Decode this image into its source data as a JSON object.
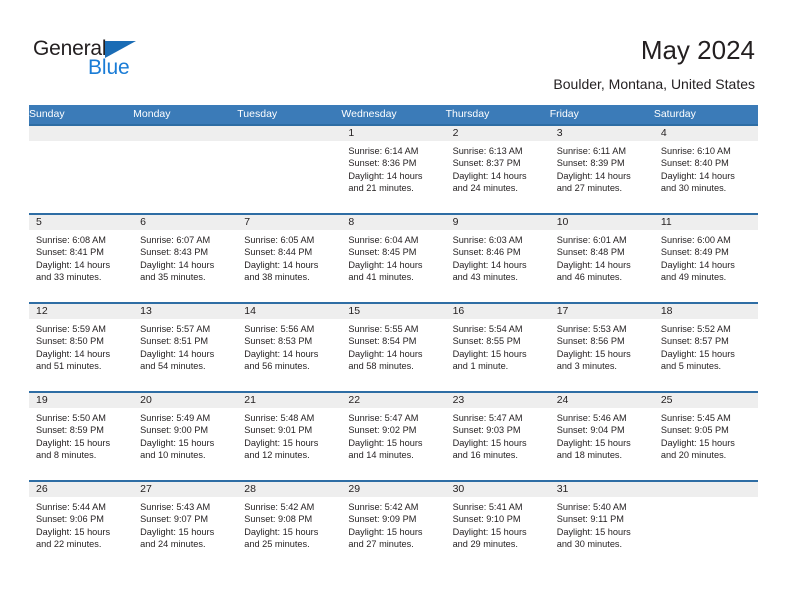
{
  "brand": {
    "name_top": "General",
    "name_bottom": "Blue",
    "triangle_color": "#1a6cb5",
    "text_color": "#231f20",
    "blue_text_color": "#1a7cd6"
  },
  "header": {
    "title": "May 2024",
    "subtitle": "Boulder, Montana, United States",
    "header_bg": "#3b7bb8",
    "row_border": "#2e6da4",
    "daynum_bg": "#eeeeee"
  },
  "weekdays": [
    "Sunday",
    "Monday",
    "Tuesday",
    "Wednesday",
    "Thursday",
    "Friday",
    "Saturday"
  ],
  "labels": {
    "sunrise": "Sunrise:",
    "sunset": "Sunset:",
    "daylight": "Daylight:"
  },
  "weeks": [
    [
      {
        "day": "",
        "sunrise": "",
        "sunset": "",
        "daylight_line1": "",
        "daylight_line2": ""
      },
      {
        "day": "",
        "sunrise": "",
        "sunset": "",
        "daylight_line1": "",
        "daylight_line2": ""
      },
      {
        "day": "",
        "sunrise": "",
        "sunset": "",
        "daylight_line1": "",
        "daylight_line2": ""
      },
      {
        "day": "1",
        "sunrise": "Sunrise: 6:14 AM",
        "sunset": "Sunset: 8:36 PM",
        "daylight_line1": "Daylight: 14 hours",
        "daylight_line2": "and 21 minutes."
      },
      {
        "day": "2",
        "sunrise": "Sunrise: 6:13 AM",
        "sunset": "Sunset: 8:37 PM",
        "daylight_line1": "Daylight: 14 hours",
        "daylight_line2": "and 24 minutes."
      },
      {
        "day": "3",
        "sunrise": "Sunrise: 6:11 AM",
        "sunset": "Sunset: 8:39 PM",
        "daylight_line1": "Daylight: 14 hours",
        "daylight_line2": "and 27 minutes."
      },
      {
        "day": "4",
        "sunrise": "Sunrise: 6:10 AM",
        "sunset": "Sunset: 8:40 PM",
        "daylight_line1": "Daylight: 14 hours",
        "daylight_line2": "and 30 minutes."
      }
    ],
    [
      {
        "day": "5",
        "sunrise": "Sunrise: 6:08 AM",
        "sunset": "Sunset: 8:41 PM",
        "daylight_line1": "Daylight: 14 hours",
        "daylight_line2": "and 33 minutes."
      },
      {
        "day": "6",
        "sunrise": "Sunrise: 6:07 AM",
        "sunset": "Sunset: 8:43 PM",
        "daylight_line1": "Daylight: 14 hours",
        "daylight_line2": "and 35 minutes."
      },
      {
        "day": "7",
        "sunrise": "Sunrise: 6:05 AM",
        "sunset": "Sunset: 8:44 PM",
        "daylight_line1": "Daylight: 14 hours",
        "daylight_line2": "and 38 minutes."
      },
      {
        "day": "8",
        "sunrise": "Sunrise: 6:04 AM",
        "sunset": "Sunset: 8:45 PM",
        "daylight_line1": "Daylight: 14 hours",
        "daylight_line2": "and 41 minutes."
      },
      {
        "day": "9",
        "sunrise": "Sunrise: 6:03 AM",
        "sunset": "Sunset: 8:46 PM",
        "daylight_line1": "Daylight: 14 hours",
        "daylight_line2": "and 43 minutes."
      },
      {
        "day": "10",
        "sunrise": "Sunrise: 6:01 AM",
        "sunset": "Sunset: 8:48 PM",
        "daylight_line1": "Daylight: 14 hours",
        "daylight_line2": "and 46 minutes."
      },
      {
        "day": "11",
        "sunrise": "Sunrise: 6:00 AM",
        "sunset": "Sunset: 8:49 PM",
        "daylight_line1": "Daylight: 14 hours",
        "daylight_line2": "and 49 minutes."
      }
    ],
    [
      {
        "day": "12",
        "sunrise": "Sunrise: 5:59 AM",
        "sunset": "Sunset: 8:50 PM",
        "daylight_line1": "Daylight: 14 hours",
        "daylight_line2": "and 51 minutes."
      },
      {
        "day": "13",
        "sunrise": "Sunrise: 5:57 AM",
        "sunset": "Sunset: 8:51 PM",
        "daylight_line1": "Daylight: 14 hours",
        "daylight_line2": "and 54 minutes."
      },
      {
        "day": "14",
        "sunrise": "Sunrise: 5:56 AM",
        "sunset": "Sunset: 8:53 PM",
        "daylight_line1": "Daylight: 14 hours",
        "daylight_line2": "and 56 minutes."
      },
      {
        "day": "15",
        "sunrise": "Sunrise: 5:55 AM",
        "sunset": "Sunset: 8:54 PM",
        "daylight_line1": "Daylight: 14 hours",
        "daylight_line2": "and 58 minutes."
      },
      {
        "day": "16",
        "sunrise": "Sunrise: 5:54 AM",
        "sunset": "Sunset: 8:55 PM",
        "daylight_line1": "Daylight: 15 hours",
        "daylight_line2": "and 1 minute."
      },
      {
        "day": "17",
        "sunrise": "Sunrise: 5:53 AM",
        "sunset": "Sunset: 8:56 PM",
        "daylight_line1": "Daylight: 15 hours",
        "daylight_line2": "and 3 minutes."
      },
      {
        "day": "18",
        "sunrise": "Sunrise: 5:52 AM",
        "sunset": "Sunset: 8:57 PM",
        "daylight_line1": "Daylight: 15 hours",
        "daylight_line2": "and 5 minutes."
      }
    ],
    [
      {
        "day": "19",
        "sunrise": "Sunrise: 5:50 AM",
        "sunset": "Sunset: 8:59 PM",
        "daylight_line1": "Daylight: 15 hours",
        "daylight_line2": "and 8 minutes."
      },
      {
        "day": "20",
        "sunrise": "Sunrise: 5:49 AM",
        "sunset": "Sunset: 9:00 PM",
        "daylight_line1": "Daylight: 15 hours",
        "daylight_line2": "and 10 minutes."
      },
      {
        "day": "21",
        "sunrise": "Sunrise: 5:48 AM",
        "sunset": "Sunset: 9:01 PM",
        "daylight_line1": "Daylight: 15 hours",
        "daylight_line2": "and 12 minutes."
      },
      {
        "day": "22",
        "sunrise": "Sunrise: 5:47 AM",
        "sunset": "Sunset: 9:02 PM",
        "daylight_line1": "Daylight: 15 hours",
        "daylight_line2": "and 14 minutes."
      },
      {
        "day": "23",
        "sunrise": "Sunrise: 5:47 AM",
        "sunset": "Sunset: 9:03 PM",
        "daylight_line1": "Daylight: 15 hours",
        "daylight_line2": "and 16 minutes."
      },
      {
        "day": "24",
        "sunrise": "Sunrise: 5:46 AM",
        "sunset": "Sunset: 9:04 PM",
        "daylight_line1": "Daylight: 15 hours",
        "daylight_line2": "and 18 minutes."
      },
      {
        "day": "25",
        "sunrise": "Sunrise: 5:45 AM",
        "sunset": "Sunset: 9:05 PM",
        "daylight_line1": "Daylight: 15 hours",
        "daylight_line2": "and 20 minutes."
      }
    ],
    [
      {
        "day": "26",
        "sunrise": "Sunrise: 5:44 AM",
        "sunset": "Sunset: 9:06 PM",
        "daylight_line1": "Daylight: 15 hours",
        "daylight_line2": "and 22 minutes."
      },
      {
        "day": "27",
        "sunrise": "Sunrise: 5:43 AM",
        "sunset": "Sunset: 9:07 PM",
        "daylight_line1": "Daylight: 15 hours",
        "daylight_line2": "and 24 minutes."
      },
      {
        "day": "28",
        "sunrise": "Sunrise: 5:42 AM",
        "sunset": "Sunset: 9:08 PM",
        "daylight_line1": "Daylight: 15 hours",
        "daylight_line2": "and 25 minutes."
      },
      {
        "day": "29",
        "sunrise": "Sunrise: 5:42 AM",
        "sunset": "Sunset: 9:09 PM",
        "daylight_line1": "Daylight: 15 hours",
        "daylight_line2": "and 27 minutes."
      },
      {
        "day": "30",
        "sunrise": "Sunrise: 5:41 AM",
        "sunset": "Sunset: 9:10 PM",
        "daylight_line1": "Daylight: 15 hours",
        "daylight_line2": "and 29 minutes."
      },
      {
        "day": "31",
        "sunrise": "Sunrise: 5:40 AM",
        "sunset": "Sunset: 9:11 PM",
        "daylight_line1": "Daylight: 15 hours",
        "daylight_line2": "and 30 minutes."
      },
      {
        "day": "",
        "sunrise": "",
        "sunset": "",
        "daylight_line1": "",
        "daylight_line2": ""
      }
    ]
  ]
}
